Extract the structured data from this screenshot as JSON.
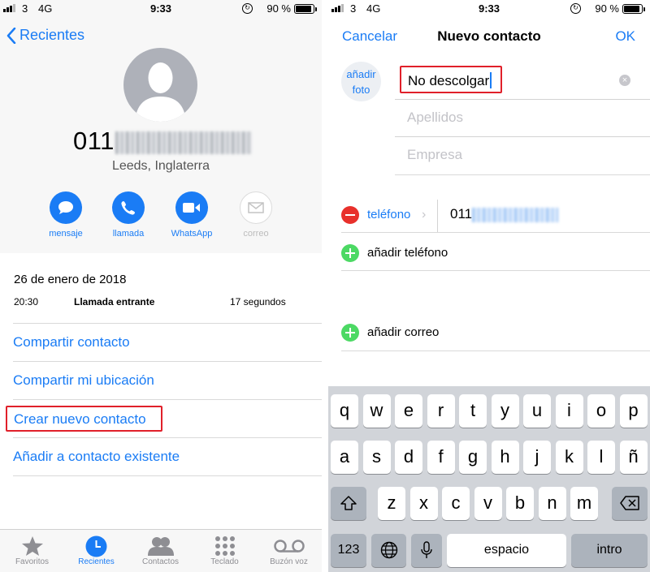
{
  "status_bar": {
    "carrier": "3",
    "network": "4G",
    "time": "9:33",
    "battery": "90 %"
  },
  "left": {
    "back_label": "Recientes",
    "number_prefix": "011",
    "location": "Leeds, Inglaterra",
    "actions": [
      {
        "label": "mensaje",
        "icon": "message-icon",
        "enabled": true
      },
      {
        "label": "llamada",
        "icon": "phone-icon",
        "enabled": true
      },
      {
        "label": "WhatsApp",
        "icon": "video-icon",
        "enabled": true
      },
      {
        "label": "correo",
        "icon": "mail-icon",
        "enabled": false
      }
    ],
    "call": {
      "date": "26 de enero de 2018",
      "time": "20:30",
      "type": "Llamada entrante",
      "duration": "17 segundos"
    },
    "links": [
      "Compartir contacto",
      "Compartir mi ubicación",
      "Crear nuevo contacto",
      "Añadir a contacto existente"
    ],
    "tabs": [
      {
        "label": "Favoritos",
        "icon": "star-icon",
        "active": false
      },
      {
        "label": "Recientes",
        "icon": "clock-icon",
        "active": true
      },
      {
        "label": "Contactos",
        "icon": "contacts-icon",
        "active": false
      },
      {
        "label": "Teclado",
        "icon": "keypad-icon",
        "active": false
      },
      {
        "label": "Buzón voz",
        "icon": "voicemail-icon",
        "active": false
      }
    ]
  },
  "right": {
    "cancel": "Cancelar",
    "title": "Nuevo contacto",
    "ok": "OK",
    "photo_label_1": "añadir",
    "photo_label_2": "foto",
    "name_value": "No descolgar",
    "lastname_placeholder": "Apellidos",
    "company_placeholder": "Empresa",
    "phone_label": "teléfono",
    "phone_prefix": "011",
    "add_phone": "añadir teléfono",
    "add_email": "añadir correo"
  },
  "keyboard": {
    "row1": [
      "q",
      "w",
      "e",
      "r",
      "t",
      "y",
      "u",
      "i",
      "o",
      "p"
    ],
    "row2": [
      "a",
      "s",
      "d",
      "f",
      "g",
      "h",
      "j",
      "k",
      "l",
      "ñ"
    ],
    "row3": [
      "z",
      "x",
      "c",
      "v",
      "b",
      "n",
      "m"
    ],
    "numbers": "123",
    "space": "espacio",
    "enter": "intro"
  },
  "colors": {
    "accent": "#1a7cf5",
    "highlight": "#e0202a",
    "add_green": "#4cd964",
    "remove_red": "#e8302b"
  }
}
